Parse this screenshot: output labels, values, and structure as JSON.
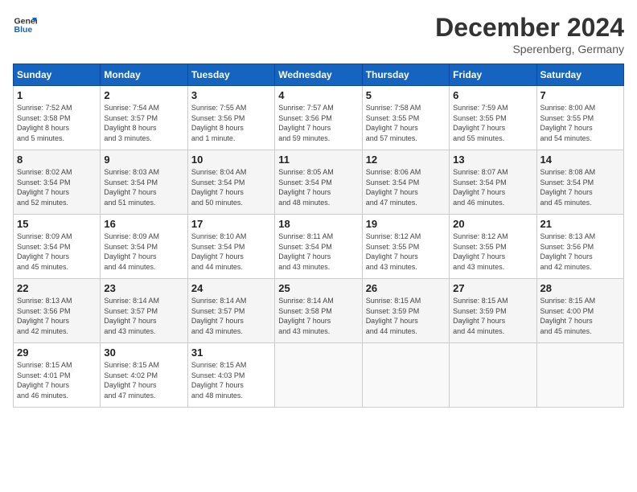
{
  "header": {
    "logo_line1": "General",
    "logo_line2": "Blue",
    "month": "December 2024",
    "location": "Sperenberg, Germany"
  },
  "days_of_week": [
    "Sunday",
    "Monday",
    "Tuesday",
    "Wednesday",
    "Thursday",
    "Friday",
    "Saturday"
  ],
  "weeks": [
    [
      {
        "num": "1",
        "sunrise": "7:52 AM",
        "sunset": "3:58 PM",
        "daylight": "8 hours and 5 minutes."
      },
      {
        "num": "2",
        "sunrise": "7:54 AM",
        "sunset": "3:57 PM",
        "daylight": "8 hours and 3 minutes."
      },
      {
        "num": "3",
        "sunrise": "7:55 AM",
        "sunset": "3:56 PM",
        "daylight": "8 hours and 1 minute."
      },
      {
        "num": "4",
        "sunrise": "7:57 AM",
        "sunset": "3:56 PM",
        "daylight": "7 hours and 59 minutes."
      },
      {
        "num": "5",
        "sunrise": "7:58 AM",
        "sunset": "3:55 PM",
        "daylight": "7 hours and 57 minutes."
      },
      {
        "num": "6",
        "sunrise": "7:59 AM",
        "sunset": "3:55 PM",
        "daylight": "7 hours and 55 minutes."
      },
      {
        "num": "7",
        "sunrise": "8:00 AM",
        "sunset": "3:55 PM",
        "daylight": "7 hours and 54 minutes."
      }
    ],
    [
      {
        "num": "8",
        "sunrise": "8:02 AM",
        "sunset": "3:54 PM",
        "daylight": "7 hours and 52 minutes."
      },
      {
        "num": "9",
        "sunrise": "8:03 AM",
        "sunset": "3:54 PM",
        "daylight": "7 hours and 51 minutes."
      },
      {
        "num": "10",
        "sunrise": "8:04 AM",
        "sunset": "3:54 PM",
        "daylight": "7 hours and 50 minutes."
      },
      {
        "num": "11",
        "sunrise": "8:05 AM",
        "sunset": "3:54 PM",
        "daylight": "7 hours and 48 minutes."
      },
      {
        "num": "12",
        "sunrise": "8:06 AM",
        "sunset": "3:54 PM",
        "daylight": "7 hours and 47 minutes."
      },
      {
        "num": "13",
        "sunrise": "8:07 AM",
        "sunset": "3:54 PM",
        "daylight": "7 hours and 46 minutes."
      },
      {
        "num": "14",
        "sunrise": "8:08 AM",
        "sunset": "3:54 PM",
        "daylight": "7 hours and 45 minutes."
      }
    ],
    [
      {
        "num": "15",
        "sunrise": "8:09 AM",
        "sunset": "3:54 PM",
        "daylight": "7 hours and 45 minutes."
      },
      {
        "num": "16",
        "sunrise": "8:09 AM",
        "sunset": "3:54 PM",
        "daylight": "7 hours and 44 minutes."
      },
      {
        "num": "17",
        "sunrise": "8:10 AM",
        "sunset": "3:54 PM",
        "daylight": "7 hours and 44 minutes."
      },
      {
        "num": "18",
        "sunrise": "8:11 AM",
        "sunset": "3:54 PM",
        "daylight": "7 hours and 43 minutes."
      },
      {
        "num": "19",
        "sunrise": "8:12 AM",
        "sunset": "3:55 PM",
        "daylight": "7 hours and 43 minutes."
      },
      {
        "num": "20",
        "sunrise": "8:12 AM",
        "sunset": "3:55 PM",
        "daylight": "7 hours and 43 minutes."
      },
      {
        "num": "21",
        "sunrise": "8:13 AM",
        "sunset": "3:56 PM",
        "daylight": "7 hours and 42 minutes."
      }
    ],
    [
      {
        "num": "22",
        "sunrise": "8:13 AM",
        "sunset": "3:56 PM",
        "daylight": "7 hours and 42 minutes."
      },
      {
        "num": "23",
        "sunrise": "8:14 AM",
        "sunset": "3:57 PM",
        "daylight": "7 hours and 43 minutes."
      },
      {
        "num": "24",
        "sunrise": "8:14 AM",
        "sunset": "3:57 PM",
        "daylight": "7 hours and 43 minutes."
      },
      {
        "num": "25",
        "sunrise": "8:14 AM",
        "sunset": "3:58 PM",
        "daylight": "7 hours and 43 minutes."
      },
      {
        "num": "26",
        "sunrise": "8:15 AM",
        "sunset": "3:59 PM",
        "daylight": "7 hours and 44 minutes."
      },
      {
        "num": "27",
        "sunrise": "8:15 AM",
        "sunset": "3:59 PM",
        "daylight": "7 hours and 44 minutes."
      },
      {
        "num": "28",
        "sunrise": "8:15 AM",
        "sunset": "4:00 PM",
        "daylight": "7 hours and 45 minutes."
      }
    ],
    [
      {
        "num": "29",
        "sunrise": "8:15 AM",
        "sunset": "4:01 PM",
        "daylight": "7 hours and 46 minutes."
      },
      {
        "num": "30",
        "sunrise": "8:15 AM",
        "sunset": "4:02 PM",
        "daylight": "7 hours and 47 minutes."
      },
      {
        "num": "31",
        "sunrise": "8:15 AM",
        "sunset": "4:03 PM",
        "daylight": "7 hours and 48 minutes."
      },
      null,
      null,
      null,
      null
    ]
  ]
}
